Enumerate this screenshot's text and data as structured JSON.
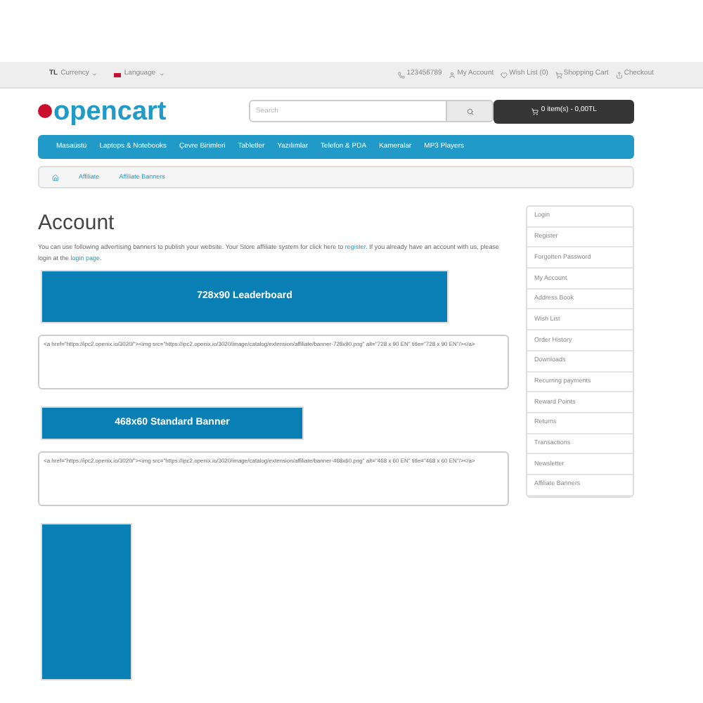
{
  "top_bar": {
    "currency": {
      "symbol": "TL",
      "label": "Currency"
    },
    "language": {
      "label": "Language"
    },
    "links": [
      {
        "kind": "phone",
        "label": "123456789"
      },
      {
        "kind": "account",
        "label": "My Account"
      },
      {
        "kind": "wish",
        "label": "Wish List (0)"
      },
      {
        "kind": "cart",
        "label": "Shopping Cart"
      },
      {
        "kind": "checkout",
        "label": "Checkout"
      }
    ]
  },
  "header": {
    "logo": "opencart",
    "search": {
      "placeholder": "Search"
    },
    "cart_button": "0 item(s) - 0,00TL"
  },
  "menu": [
    "Masaüstü",
    "Laptops & Notebooks",
    "Çevre Birimleri",
    "Tabletler",
    "Yazılımlar",
    "Telefon & PDA",
    "Kameralar",
    "MP3 Players"
  ],
  "breadcrumb": [
    "Affiliate",
    "Affiliate Banners"
  ],
  "content": {
    "title": "Account",
    "intro": {
      "before": "You can use following advertising banners to publish your website. Your Store affiliate system for click here to ",
      "link1": "register",
      "middle": ". If you already have an account with us, please login at the ",
      "link2": "login page",
      "after": "."
    },
    "banners": [
      {
        "kind": "leaderboard",
        "label": "728x90 Leaderboard",
        "code": "<a href=\"https://ipc2.openix.io/3020/\"><img src=\"https://ipc2.openix.io/3020/image/catalog/extension/affiliate/banner-728x90.png\" alt=\"728 x 90 EN\" title=\"728 x 90 EN\"/></a>"
      },
      {
        "kind": "standard",
        "label": "468x60 Standard Banner",
        "code": "<a href=\"https://ipc2.openix.io/3020/\"><img src=\"https://ipc2.openix.io/3020/image/catalog/extension/affiliate/banner-468x60.png\" alt=\"468 x 60 EN\" title=\"468 x 60 EN\"/></a>"
      },
      {
        "kind": "skyscraper"
      }
    ]
  },
  "sidebar": [
    "Login",
    "Register",
    "Forgotten Password",
    "My Account",
    "Address Book",
    "Wish List",
    "Order History",
    "Downloads",
    "Recurring payments",
    "Reward Points",
    "Returns",
    "Transactions",
    "Newsletter",
    "Affiliate Banners"
  ]
}
